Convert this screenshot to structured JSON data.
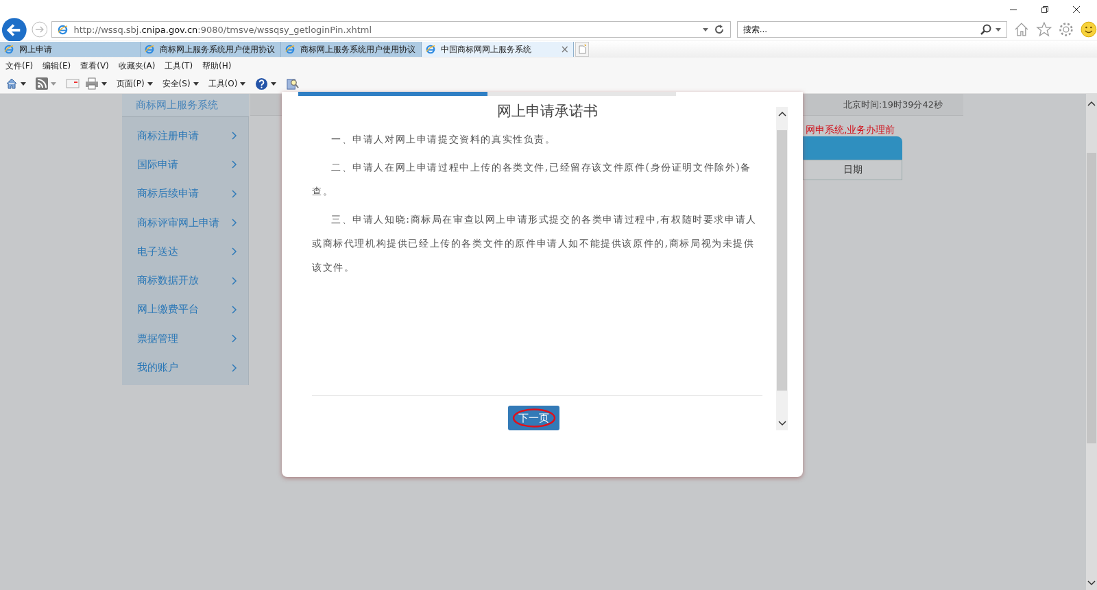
{
  "browser": {
    "address": "http://wssq.sbj.**cnipa.gov.cn**:9080/tmsve/wssqsy_getloginPin.xhtml",
    "search": {
      "placeholder": "搜索..."
    },
    "tabs": [
      {
        "label": "网上申请",
        "selected": false
      },
      {
        "label": "商标网上服务系统用户使用协议",
        "selected": false
      },
      {
        "label": "商标网上服务系统用户使用协议",
        "selected": false
      },
      {
        "label": "中国商标网网上服务系统",
        "selected": true,
        "close": "×"
      }
    ],
    "menu": [
      "文件(F)",
      "编辑(E)",
      "查看(V)",
      "收藏夹(A)",
      "工具(T)",
      "帮助(H)"
    ],
    "toolbar": [
      "页面(P)",
      "安全(S)",
      "工具(O)"
    ]
  },
  "sidebar": {
    "title": "商标网上服务系统",
    "items": [
      "商标注册申请",
      "国际申请",
      "商标后续申请",
      "商标评审网上申请",
      "电子送达",
      "商标数据开放",
      "网上缴费平台",
      "票据管理",
      "我的账户"
    ]
  },
  "page": {
    "clock": "北京时间:19时39分42秒",
    "notice": "网申系统,业务办理前",
    "table_header": "日期"
  },
  "modal": {
    "progress": {
      "level": 0.5
    },
    "title": "网上申请承诺书",
    "paragraphs": [
      "一、申请人对网上申请提交资料的真实性负责。",
      "二、申请人在网上申请过程中上传的各类文件,已经留存该文件原件(身份证明文件除外)备查。",
      "三、申请人知晓:商标局在审查以网上申请形式提交的各类申请过程中,有权随时要求申请人或商标代理机构提供已经上传的各类文件的原件申请人如不能提供该原件的,商标局视为未提供该文件。"
    ],
    "next_button": "下一页"
  }
}
